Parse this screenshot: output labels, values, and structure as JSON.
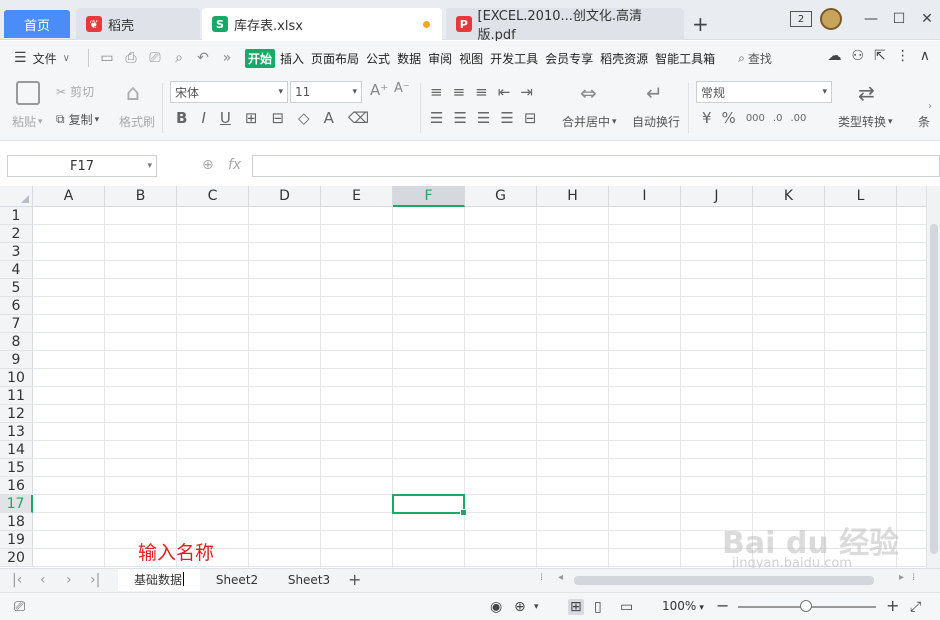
{
  "tabs": {
    "home": "首页",
    "daoke": "稻壳",
    "xlsx": "库存表.xlsx",
    "pdf": "[EXCEL.2010...创文化.高清版.pdf",
    "add": "+"
  },
  "window": {
    "badge": "2",
    "minimize": "—",
    "restore": "☐",
    "close": "✕"
  },
  "menu": {
    "file": "文件",
    "items": [
      "开始",
      "插入",
      "页面布局",
      "公式",
      "数据",
      "审阅",
      "视图",
      "开发工具",
      "会员专享",
      "稻壳资源",
      "智能工具箱"
    ],
    "active": "开始",
    "search": "查找"
  },
  "ribbon": {
    "paste": "粘贴",
    "cut": "剪切",
    "copy": "复制",
    "format_painter": "格式刷",
    "font_name": "宋体",
    "font_size": "11",
    "merge_center": "合并居中",
    "wrap_text": "自动换行",
    "number_format": "常规",
    "type_convert": "类型转换",
    "overflow": "条"
  },
  "formula_bar": {
    "cell_ref": "F17",
    "fx": "fx",
    "value": ""
  },
  "grid": {
    "columns": [
      "A",
      "B",
      "C",
      "D",
      "E",
      "F",
      "G",
      "H",
      "I",
      "J",
      "K",
      "L"
    ],
    "rows": [
      "1",
      "2",
      "3",
      "4",
      "5",
      "6",
      "7",
      "8",
      "9",
      "10",
      "11",
      "12",
      "13",
      "14",
      "15",
      "16",
      "17",
      "18",
      "19",
      "20"
    ],
    "selected_column": "F",
    "selected_row": "17"
  },
  "annotation": "输入名称",
  "sheets": [
    "基础数据",
    "Sheet2",
    "Sheet3"
  ],
  "active_sheet": "基础数据",
  "status": {
    "zoom": "100%"
  },
  "watermark": {
    "brand": "Bai du 经验",
    "url": "jingyan.baidu.com"
  },
  "colors": {
    "accent": "#1aa868",
    "home_tab": "#4b8df8",
    "annotation": "#e02020"
  }
}
